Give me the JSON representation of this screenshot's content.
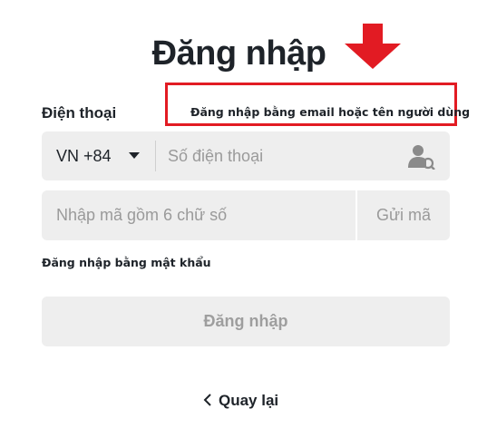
{
  "header": {
    "title": "Đăng nhập"
  },
  "phone_field": {
    "label": "Điện thoại",
    "country_code": "VN +84",
    "placeholder": "Số điện thoại",
    "value": ""
  },
  "alt_login": {
    "link": "Đăng nhập bằng email hoặc tên người dùng"
  },
  "code_field": {
    "placeholder": "Nhập mã gồm 6 chữ số",
    "value": "",
    "send_label": "Gửi mã"
  },
  "password_link": "Đăng nhập bằng mật khẩu",
  "submit_label": "Đăng nhập",
  "back_label": "Quay lại",
  "icons": {
    "arrow": "down-arrow-icon",
    "dropdown": "caret-down-icon",
    "contact": "contact-user-icon",
    "back": "chevron-left-icon"
  },
  "colors": {
    "annotation_red": "#e21b23",
    "text": "#1e2329",
    "field_bg": "#eeeeee",
    "placeholder": "#9a9a9a"
  }
}
